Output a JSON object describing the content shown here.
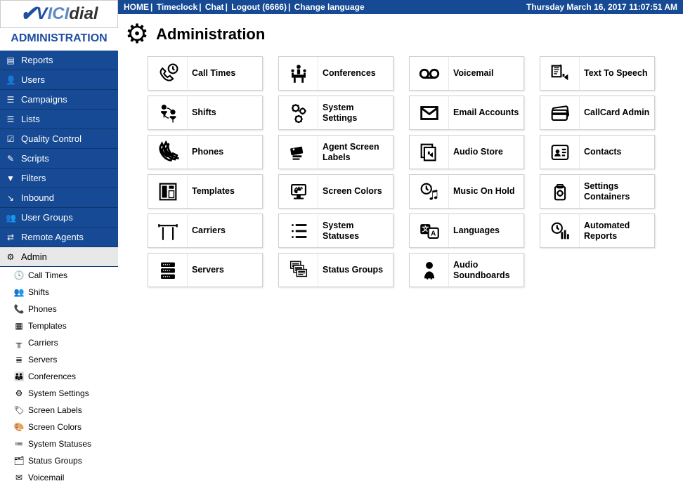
{
  "logo": {
    "text": "VICIdial"
  },
  "admin_title": "ADMINISTRATION",
  "topbar": {
    "links": [
      "HOME",
      "Timeclock",
      "Chat",
      "Logout (6666)",
      "Change language"
    ],
    "datetime": "Thursday March 16, 2017 11:07:51 AM"
  },
  "page": {
    "title": "Administration"
  },
  "nav": [
    {
      "label": "Reports",
      "icon": "≡"
    },
    {
      "label": "Users",
      "icon": "👤"
    },
    {
      "label": "Campaigns",
      "icon": "☰"
    },
    {
      "label": "Lists",
      "icon": "☰"
    },
    {
      "label": "Quality Control",
      "icon": "☑"
    },
    {
      "label": "Scripts",
      "icon": "✎"
    },
    {
      "label": "Filters",
      "icon": "▼"
    },
    {
      "label": "Inbound",
      "icon": "↘"
    },
    {
      "label": "User Groups",
      "icon": "👥"
    },
    {
      "label": "Remote Agents",
      "icon": "⇄"
    },
    {
      "label": "Admin",
      "icon": "⚙",
      "active": true
    }
  ],
  "subnav": [
    {
      "label": "Call Times",
      "icon": "clock"
    },
    {
      "label": "Shifts",
      "icon": "shifts"
    },
    {
      "label": "Phones",
      "icon": "phone"
    },
    {
      "label": "Templates",
      "icon": "template"
    },
    {
      "label": "Carriers",
      "icon": "carrier"
    },
    {
      "label": "Servers",
      "icon": "server"
    },
    {
      "label": "Conferences",
      "icon": "conf"
    },
    {
      "label": "System Settings",
      "icon": "sysset"
    },
    {
      "label": "Screen Labels",
      "icon": "labels"
    },
    {
      "label": "Screen Colors",
      "icon": "colors"
    },
    {
      "label": "System Statuses",
      "icon": "statuses"
    },
    {
      "label": "Status Groups",
      "icon": "groups"
    },
    {
      "label": "Voicemail",
      "icon": "vm"
    }
  ],
  "tiles": {
    "col0": [
      {
        "label": "Call Times",
        "icon": "calltimes"
      },
      {
        "label": "Shifts",
        "icon": "shifts"
      },
      {
        "label": "Phones",
        "icon": "phones"
      },
      {
        "label": "Templates",
        "icon": "templates"
      },
      {
        "label": "Carriers",
        "icon": "carriers"
      },
      {
        "label": "Servers",
        "icon": "servers"
      }
    ],
    "col1": [
      {
        "label": "Conferences",
        "icon": "conferences"
      },
      {
        "label": "System Settings",
        "icon": "settings"
      },
      {
        "label": "Agent Screen Labels",
        "icon": "labels"
      },
      {
        "label": "Screen Colors",
        "icon": "colors"
      },
      {
        "label": "System Statuses",
        "icon": "statuses"
      },
      {
        "label": "Status Groups",
        "icon": "groups"
      }
    ],
    "col2": [
      {
        "label": "Voicemail",
        "icon": "voicemail"
      },
      {
        "label": "Email Accounts",
        "icon": "email"
      },
      {
        "label": "Audio Store",
        "icon": "audiostore"
      },
      {
        "label": "Music On Hold",
        "icon": "moh"
      },
      {
        "label": "Languages",
        "icon": "languages"
      },
      {
        "label": "Audio Soundboards",
        "icon": "soundboards"
      }
    ],
    "col3": [
      {
        "label": "Text To Speech",
        "icon": "tts"
      },
      {
        "label": "CallCard Admin",
        "icon": "callcard"
      },
      {
        "label": "Contacts",
        "icon": "contacts"
      },
      {
        "label": "Settings Containers",
        "icon": "containers"
      },
      {
        "label": "Automated Reports",
        "icon": "autorep"
      }
    ]
  }
}
